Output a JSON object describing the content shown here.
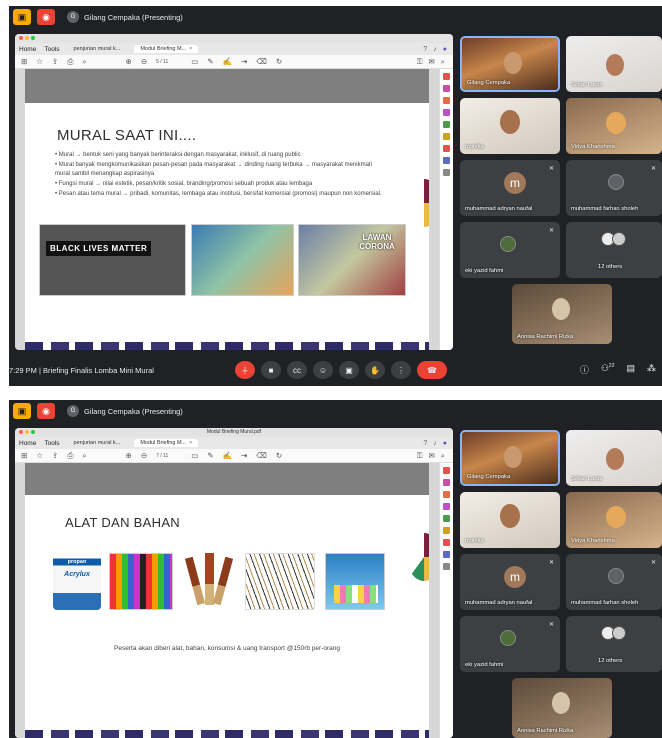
{
  "meeting": {
    "presenter_label": "Gilang Cempaka (Presenting)",
    "time_title": "7:29 PM  |  Briefing Finalis Lomba Mini Mural",
    "participant_count": "22"
  },
  "pdf": {
    "window_title": "Modul Briefing Mural.pdf",
    "menu_home": "Home",
    "menu_tools": "Tools",
    "tab1": "penjurian mural k...",
    "tab2": "Modul Briefing M...",
    "page_indicator1": "5 / 11",
    "page_indicator2": "7 / 11"
  },
  "slide1": {
    "title": "MURAL SAAT INI....",
    "bullets": [
      "•  Mural → bentuk seni yang banyak berinteraksi dengan masyarakat, inklusif, di ruang public",
      "•  Mural banyak mengkomunikasikan pesan-pesan pada masyarakat → dinding ruang terbuka → masyarakat menikmati mural sambil menangkap aspirasinya",
      "•  Fungsi mural → nilai estetik, pesan/kritik sosial, branding/promosi sebuah produk atau lembaga",
      "•  Pesan atau tema mural → pribadi,  komunitas, lembaga atau institusi, bersifat komersial (promosi) maupun non komersial."
    ],
    "photo1_text": "BLACK LIVES MATTER",
    "photo3_text": "LAWAN CORONA"
  },
  "slide2": {
    "title": "ALAT DAN BAHAN",
    "product1_brand": "propan",
    "product1_name": "Acrylux",
    "caption": "Peserta akan diberi alat, bahan, konsumsi & uang transport @150rb per-orang"
  },
  "participants": {
    "p1": "Gilang Cempaka",
    "p2": "Sekar Laras",
    "p3": "monika",
    "p4": "Vidya Kharishma",
    "p5": "muhammad adryan naufal",
    "p5_initial": "m",
    "p6": "muhammad farhan sholeh",
    "p7": "eki yazid fahmi",
    "p8": "12 others",
    "p9": "Annisa Rachimi Rizka"
  }
}
